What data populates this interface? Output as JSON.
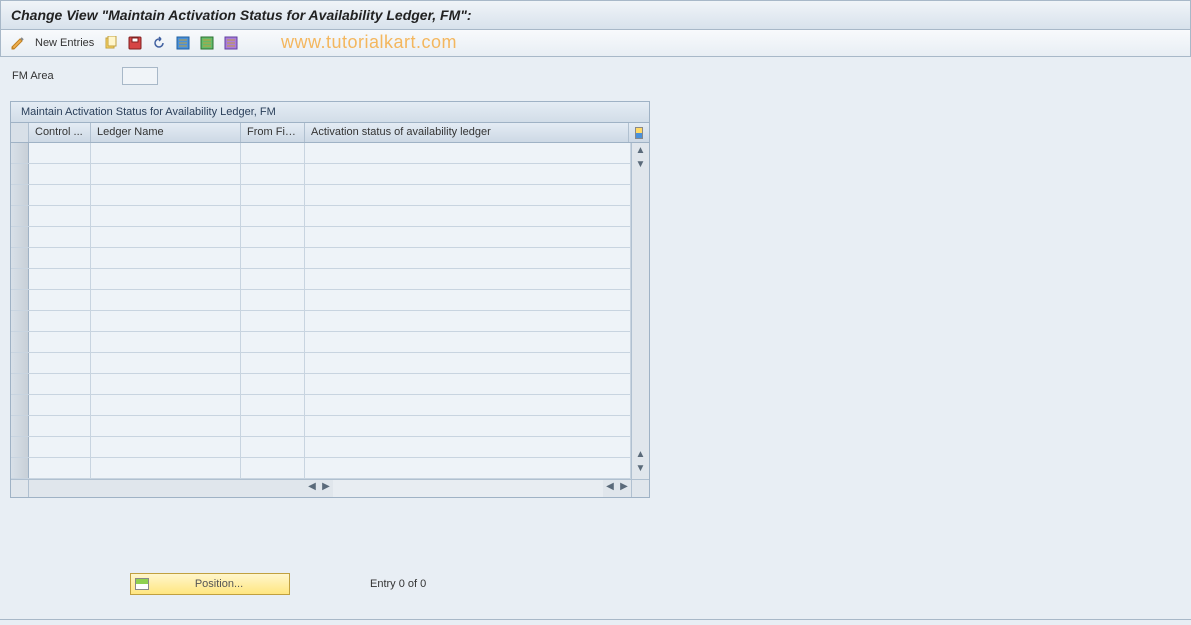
{
  "title": "Change View \"Maintain Activation Status for Availability Ledger, FM\":",
  "toolbar": {
    "new_entries_label": "New Entries"
  },
  "watermark": "www.tutorialkart.com",
  "form": {
    "fm_area_label": "FM Area",
    "fm_area_value": ""
  },
  "table": {
    "title": "Maintain Activation Status for Availability Ledger, FM",
    "columns": {
      "control": "Control ...",
      "ledger_name": "Ledger Name",
      "from_fis": "From Fis...",
      "activation_status": "Activation status of availability ledger"
    },
    "row_count": 16
  },
  "footer": {
    "position_label": "Position...",
    "entry_label": "Entry 0 of 0"
  }
}
